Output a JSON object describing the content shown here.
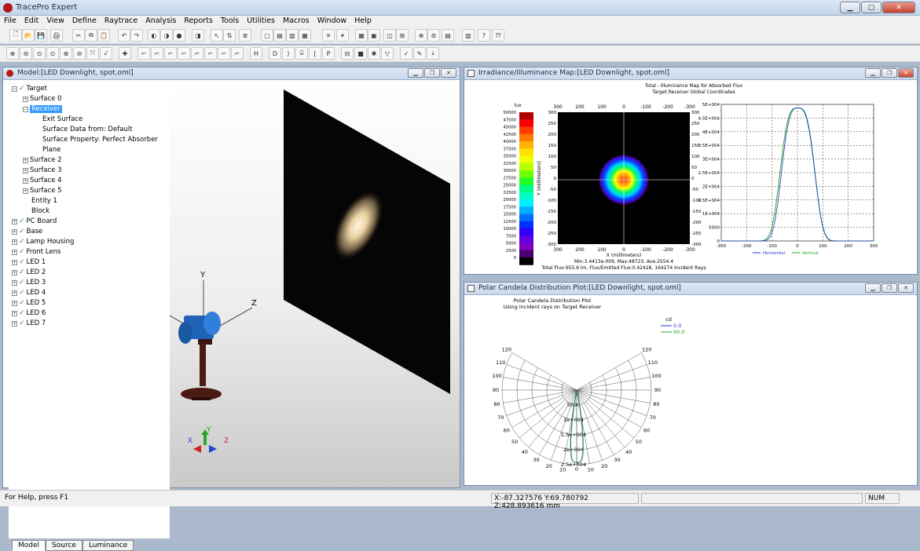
{
  "app": {
    "title": "TracePro Expert",
    "menus": [
      "File",
      "Edit",
      "View",
      "Define",
      "Raytrace",
      "Analysis",
      "Reports",
      "Tools",
      "Utilities",
      "Macros",
      "Window",
      "Help"
    ]
  },
  "model_window": {
    "title": "Model:[LED Downlight, spot.oml]",
    "tabs": [
      "Model",
      "Source",
      "Luminance"
    ],
    "tree": [
      {
        "label": "Target",
        "level": 0,
        "exp": "−",
        "chk": true
      },
      {
        "label": "Surface 0",
        "level": 1,
        "exp": "+",
        "chk": false
      },
      {
        "label": "Receiver",
        "level": 1,
        "exp": "−",
        "chk": false,
        "sel": true
      },
      {
        "label": "Exit Surface",
        "level": 2,
        "exp": "",
        "chk": false
      },
      {
        "label": "Surface Data from: Default",
        "level": 2,
        "exp": "",
        "chk": false
      },
      {
        "label": "Surface Property: Perfect Absorber",
        "level": 2,
        "exp": "",
        "chk": false
      },
      {
        "label": "Plane",
        "level": 2,
        "exp": "",
        "chk": false
      },
      {
        "label": "Surface 2",
        "level": 1,
        "exp": "+",
        "chk": false
      },
      {
        "label": "Surface 3",
        "level": 1,
        "exp": "+",
        "chk": false
      },
      {
        "label": "Surface 4",
        "level": 1,
        "exp": "+",
        "chk": false
      },
      {
        "label": "Surface 5",
        "level": 1,
        "exp": "+",
        "chk": false
      },
      {
        "label": "Entity 1",
        "level": 1,
        "exp": "",
        "chk": false
      },
      {
        "label": "Block",
        "level": 1,
        "exp": "",
        "chk": false
      },
      {
        "label": "PC Board",
        "level": 0,
        "exp": "+",
        "chk": true
      },
      {
        "label": "Base",
        "level": 0,
        "exp": "+",
        "chk": true
      },
      {
        "label": "Lamp Housing",
        "level": 0,
        "exp": "+",
        "chk": true
      },
      {
        "label": "Front Lens",
        "level": 0,
        "exp": "+",
        "chk": true
      },
      {
        "label": "LED 1",
        "level": 0,
        "exp": "+",
        "chk": true
      },
      {
        "label": "LED 2",
        "level": 0,
        "exp": "+",
        "chk": true
      },
      {
        "label": "LED 3",
        "level": 0,
        "exp": "+",
        "chk": true
      },
      {
        "label": "LED 4",
        "level": 0,
        "exp": "+",
        "chk": true
      },
      {
        "label": "LED 5",
        "level": 0,
        "exp": "+",
        "chk": true
      },
      {
        "label": "LED 6",
        "level": 0,
        "exp": "+",
        "chk": true
      },
      {
        "label": "LED 7",
        "level": 0,
        "exp": "+",
        "chk": true
      }
    ],
    "axes": {
      "y": "Y",
      "z": "Z",
      "triad_x": "X",
      "triad_y": "Y",
      "triad_z": "Z"
    }
  },
  "irr_window": {
    "title": "Irradiance/Illuminance Map:[LED Downlight, spot.oml]",
    "plot_title": "Total - Illuminance Map for Absorbed Flux",
    "plot_subtitle": "Target Receiver   Global Coordinates",
    "unit": "lux",
    "colorbar": [
      "50000",
      "47500",
      "45000",
      "42500",
      "40000",
      "37500",
      "35000",
      "32500",
      "30000",
      "27500",
      "25000",
      "22500",
      "20000",
      "17500",
      "15000",
      "12500",
      "10000",
      "7500",
      "5000",
      "2500",
      "0"
    ],
    "xticks": [
      "300",
      "200",
      "100",
      "0",
      "-100",
      "-200",
      "-300"
    ],
    "yticks": [
      "300",
      "250",
      "200",
      "150",
      "100",
      "50",
      "0",
      "-50",
      "-100",
      "-150",
      "-200",
      "-250",
      "-300"
    ],
    "xlabel": "X (millimeters)",
    "ylabel": "Y (millimeters)",
    "stats1": "Min:3.4413e-009, Max:48723, Ave:2554.4",
    "stats2": "Total Flux:955.6 lm, Flux/Emitted Flux:0.42428, 164274 Incident Rays",
    "profile_yticks": [
      "5E+004",
      "4.5E+004",
      "4E+004",
      "3.5E+004",
      "3E+004",
      "2.5E+004",
      "2E+004",
      "1.5E+004",
      "1E+004",
      "5000",
      "0"
    ],
    "profile_xticks": [
      "-300",
      "-200",
      "-100",
      "0",
      "100",
      "200",
      "300"
    ],
    "legend": [
      "Horizontal",
      "Vertical"
    ],
    "colors": {
      "horizontal": "#2233cc",
      "vertical": "#22aa22"
    }
  },
  "polar_window": {
    "title": "Polar Candela Distribution Plot:[LED Downlight, spot.oml]",
    "plot_title": "Polar Candela Distribution Plot",
    "plot_subtitle": "Using incident rays on Target Receiver",
    "unit": "cd",
    "legend": [
      "0.0",
      "90.0"
    ],
    "left_angles": [
      "120",
      "110",
      "100",
      "90",
      "80",
      "70",
      "60",
      "50",
      "40",
      "30",
      "20",
      "10"
    ],
    "right_angles": [
      "120",
      "110",
      "100",
      "90",
      "80",
      "70",
      "60",
      "50",
      "40",
      "30",
      "20",
      "10"
    ],
    "bottom": "0",
    "radial": [
      "5000",
      "1e+004",
      "1.5e+004",
      "2e+004",
      "2.5e+004"
    ]
  },
  "status": {
    "help": "For Help, press F1",
    "coords": "X:-87.327576 Y:69.780792 Z:428.893616 mm",
    "num": "NUM"
  }
}
